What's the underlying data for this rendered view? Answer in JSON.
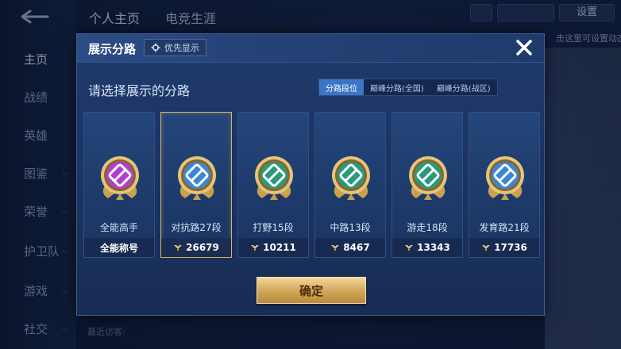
{
  "background": {
    "tabs": [
      {
        "label": "个人主页",
        "active": true
      },
      {
        "label": "电竞生涯",
        "active": false
      }
    ],
    "sidebar": [
      {
        "label": "主页",
        "active": true,
        "chevron": false
      },
      {
        "label": "战绩",
        "active": false,
        "chevron": false
      },
      {
        "label": "英雄",
        "active": false,
        "chevron": false
      },
      {
        "label": "图鉴",
        "active": false,
        "chevron": true
      },
      {
        "label": "荣誉",
        "active": false,
        "chevron": true
      },
      {
        "label": "护卫队",
        "active": false,
        "chevron": true
      },
      {
        "label": "游戏",
        "active": false,
        "chevron": true
      },
      {
        "label": "社交",
        "active": false,
        "chevron": true
      }
    ],
    "settings_label": "设置",
    "hint_text": "击这里可设置动态",
    "recent_visitors": "最近访客:"
  },
  "modal": {
    "title": "展示分路",
    "priority_label": "优先显示",
    "prompt": "请选择展示的分路",
    "segments": [
      {
        "label": "分路段位",
        "active": true
      },
      {
        "label": "巅峰分路(全国)",
        "active": false
      },
      {
        "label": "巅峰分路(战区)",
        "active": false
      }
    ],
    "cards": [
      {
        "name": "全能高手",
        "value": "全能称号",
        "selected": false,
        "badge": "all-round-badge-icon",
        "emblem_color": "#b03fd0",
        "has_bolt": false
      },
      {
        "name": "对抗路27段",
        "value": "26679",
        "selected": true,
        "badge": "clash-lane-badge-icon",
        "emblem_color": "#3b86d6",
        "has_bolt": true
      },
      {
        "name": "打野15段",
        "value": "10211",
        "selected": false,
        "badge": "jungle-badge-icon",
        "emblem_color": "#2a9a7c",
        "has_bolt": true
      },
      {
        "name": "中路13段",
        "value": "8467",
        "selected": false,
        "badge": "mid-lane-badge-icon",
        "emblem_color": "#2a9a7c",
        "has_bolt": true
      },
      {
        "name": "游走18段",
        "value": "13343",
        "selected": false,
        "badge": "roam-badge-icon",
        "emblem_color": "#2a9a7c",
        "has_bolt": true
      },
      {
        "name": "发育路21段",
        "value": "17736",
        "selected": false,
        "badge": "farm-lane-badge-icon",
        "emblem_color": "#3b86d6",
        "has_bolt": true
      }
    ],
    "confirm_label": "确定"
  },
  "colors": {
    "accent_gold": "#d3a85c",
    "tab_active_blue": "#3a76c6",
    "panel_blue": "#1f3a6e"
  }
}
